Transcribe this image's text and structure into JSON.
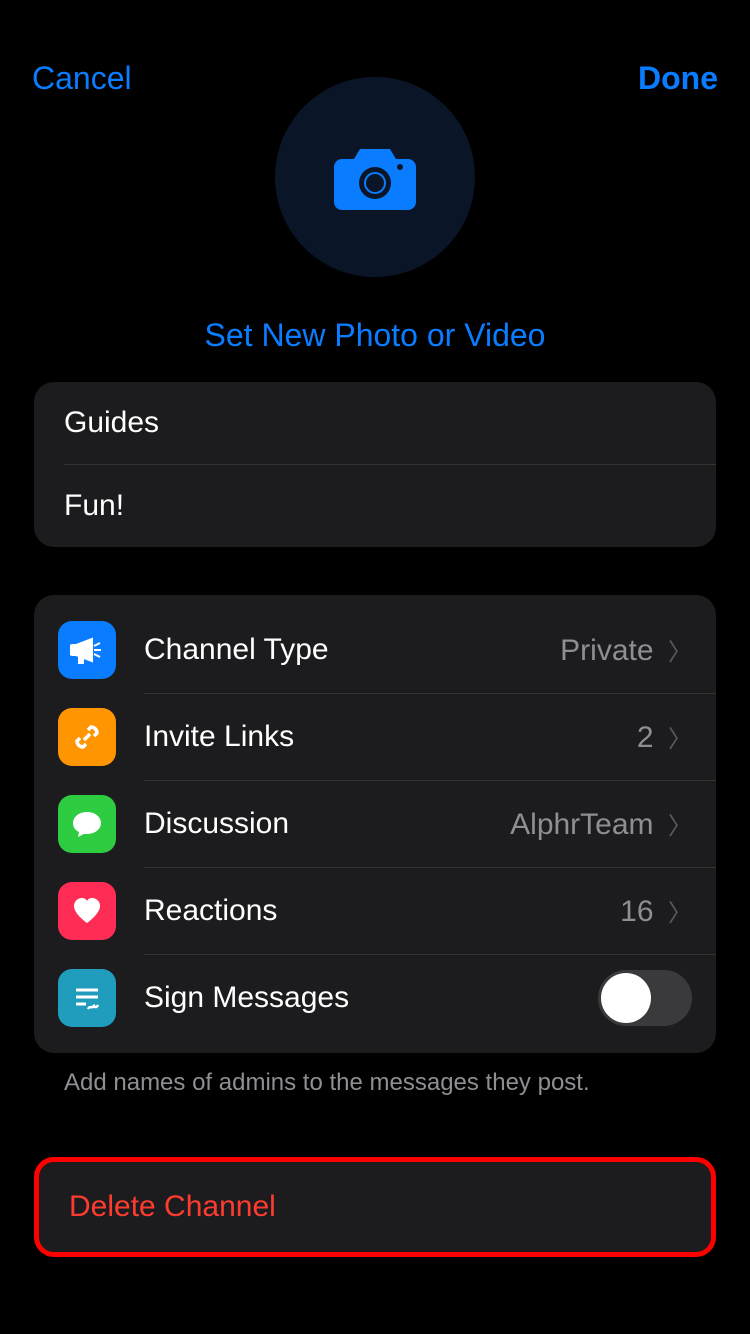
{
  "header": {
    "cancel_label": "Cancel",
    "done_label": "Done"
  },
  "photo": {
    "link_label": "Set New Photo or Video"
  },
  "info": {
    "name": "Guides",
    "description": "Fun!"
  },
  "settings": {
    "channel_type": {
      "label": "Channel Type",
      "value": "Private"
    },
    "invite_links": {
      "label": "Invite Links",
      "value": "2"
    },
    "discussion": {
      "label": "Discussion",
      "value": "AlphrTeam"
    },
    "reactions": {
      "label": "Reactions",
      "value": "16"
    },
    "sign_messages": {
      "label": "Sign Messages",
      "on": false
    }
  },
  "footer_note": "Add names of admins to the messages they post.",
  "delete_label": "Delete Channel"
}
